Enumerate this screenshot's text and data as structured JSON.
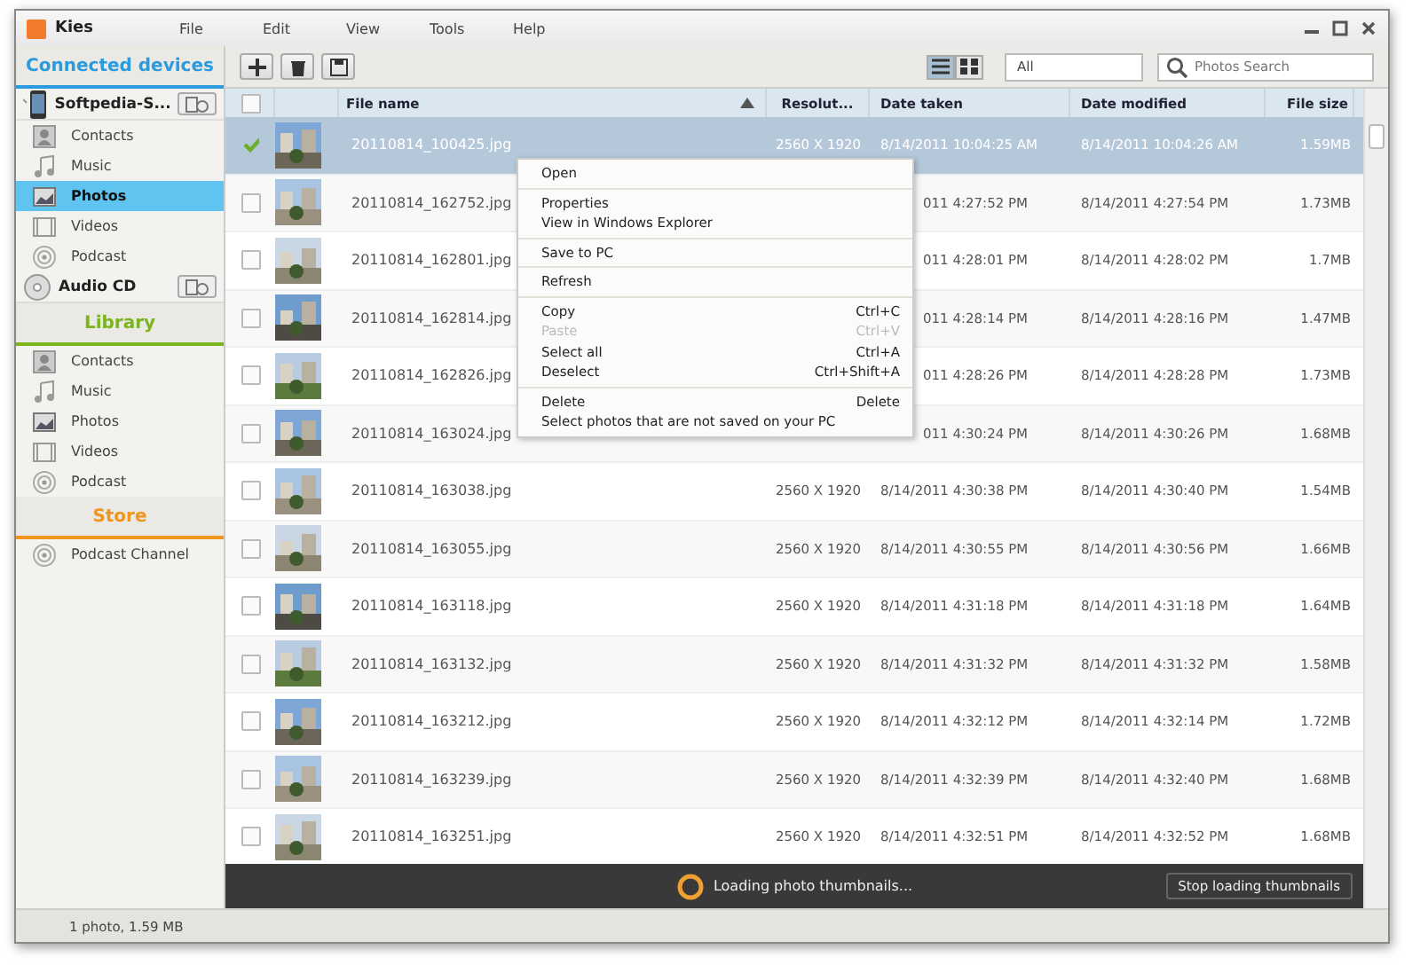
{
  "window": {
    "title": "Kies",
    "menu": [
      "File",
      "Edit",
      "View",
      "Tools",
      "Help"
    ]
  },
  "sidebar": {
    "sections": [
      {
        "title": "Connected devices",
        "color": "#2a9be0",
        "devices": [
          {
            "name": "Softpedia-S...",
            "kind": "phone",
            "items": [
              {
                "label": "Contacts",
                "kind": "contacts",
                "selected": false
              },
              {
                "label": "Music",
                "kind": "music",
                "selected": false
              },
              {
                "label": "Photos",
                "kind": "photos",
                "selected": true
              },
              {
                "label": "Videos",
                "kind": "videos",
                "selected": false
              },
              {
                "label": "Podcast",
                "kind": "podcast",
                "selected": false
              }
            ]
          },
          {
            "name": "Audio CD",
            "kind": "cd"
          }
        ]
      },
      {
        "title": "Library",
        "color": "#7ab51d",
        "items": [
          {
            "label": "Contacts",
            "kind": "contacts",
            "selected": false
          },
          {
            "label": "Music",
            "kind": "music",
            "selected": false
          },
          {
            "label": "Photos",
            "kind": "photos",
            "selected": false
          },
          {
            "label": "Videos",
            "kind": "videos",
            "selected": false
          },
          {
            "label": "Podcast",
            "kind": "podcast",
            "selected": false
          }
        ]
      },
      {
        "title": "Store",
        "color": "#f0961e",
        "items": [
          {
            "label": "Podcast Channel",
            "kind": "podcast",
            "selected": false
          }
        ]
      }
    ]
  },
  "toolbar": {
    "views": [
      {
        "kind": "list",
        "selected": true
      },
      {
        "kind": "grid",
        "selected": false
      }
    ],
    "filter": "All",
    "search": {
      "placeholder": "Photos Search"
    }
  },
  "table": {
    "select_all_checked": false,
    "columns": [
      "File name",
      "Resolut...",
      "Date taken",
      "Date modified",
      "File size"
    ],
    "rows": [
      {
        "file": "20110814_100425.jpg",
        "resolution": "2560 X 1920",
        "taken": "8/14/2011 10:04:25 AM",
        "modified": "8/14/2011 10:04:26 AM",
        "size": "1.59MB",
        "selected": true,
        "checked": true
      },
      {
        "file": "20110814_162752.jpg",
        "taken": "011 4:27:52 PM",
        "modified": "8/14/2011 4:27:54 PM",
        "size": "1.73MB",
        "selected": false,
        "checked": false
      },
      {
        "file": "20110814_162801.jpg",
        "taken": "011 4:28:01 PM",
        "modified": "8/14/2011 4:28:02 PM",
        "size": "1.7MB",
        "selected": false,
        "checked": false
      },
      {
        "file": "20110814_162814.jpg",
        "taken": "011 4:28:14 PM",
        "modified": "8/14/2011 4:28:16 PM",
        "size": "1.47MB",
        "selected": false,
        "checked": false
      },
      {
        "file": "20110814_162826.jpg",
        "taken": "011 4:28:26 PM",
        "modified": "8/14/2011 4:28:28 PM",
        "size": "1.73MB",
        "selected": false,
        "checked": false
      },
      {
        "file": "20110814_163024.jpg",
        "taken": "011 4:30:24 PM",
        "modified": "8/14/2011 4:30:26 PM",
        "size": "1.68MB",
        "selected": false,
        "checked": false
      },
      {
        "file": "20110814_163038.jpg",
        "resolution": "2560 X 1920",
        "taken": "8/14/2011 4:30:38 PM",
        "modified": "8/14/2011 4:30:40 PM",
        "size": "1.54MB",
        "selected": false,
        "checked": false
      },
      {
        "file": "20110814_163055.jpg",
        "resolution": "2560 X 1920",
        "taken": "8/14/2011 4:30:55 PM",
        "modified": "8/14/2011 4:30:56 PM",
        "size": "1.66MB",
        "selected": false,
        "checked": false
      },
      {
        "file": "20110814_163118.jpg",
        "resolution": "2560 X 1920",
        "taken": "8/14/2011 4:31:18 PM",
        "modified": "8/14/2011 4:31:18 PM",
        "size": "1.64MB",
        "selected": false,
        "checked": false
      },
      {
        "file": "20110814_163132.jpg",
        "resolution": "2560 X 1920",
        "taken": "8/14/2011 4:31:32 PM",
        "modified": "8/14/2011 4:31:32 PM",
        "size": "1.58MB",
        "selected": false,
        "checked": false
      },
      {
        "file": "20110814_163212.jpg",
        "resolution": "2560 X 1920",
        "taken": "8/14/2011 4:32:12 PM",
        "modified": "8/14/2011 4:32:14 PM",
        "size": "1.72MB",
        "selected": false,
        "checked": false
      },
      {
        "file": "20110814_163239.jpg",
        "resolution": "2560 X 1920",
        "taken": "8/14/2011 4:32:39 PM",
        "modified": "8/14/2011 4:32:40 PM",
        "size": "1.68MB",
        "selected": false,
        "checked": false
      },
      {
        "file": "20110814_163251.jpg",
        "resolution": "2560 X 1920",
        "taken": "8/14/2011 4:32:51 PM",
        "modified": "8/14/2011 4:32:52 PM",
        "size": "1.68MB",
        "selected": false,
        "checked": false
      }
    ]
  },
  "context_menu": {
    "groups": [
      [
        {
          "label": "Open",
          "disabled": false
        }
      ],
      [
        {
          "label": "Properties",
          "disabled": false
        },
        {
          "label": "View in Windows Explorer",
          "disabled": false
        }
      ],
      [
        {
          "label": "Save to PC",
          "disabled": false
        }
      ],
      [
        {
          "label": "Refresh",
          "disabled": false
        }
      ],
      [
        {
          "label": "Copy",
          "shortcut": "Ctrl+C",
          "disabled": false
        },
        {
          "label": "Paste",
          "shortcut": "Ctrl+V",
          "disabled": true
        },
        {
          "label": "Select all",
          "shortcut": "Ctrl+A",
          "disabled": false
        },
        {
          "label": "Deselect",
          "shortcut": "Ctrl+Shift+A",
          "disabled": false
        }
      ],
      [
        {
          "label": "Delete",
          "shortcut": "Delete",
          "disabled": false
        },
        {
          "label": "Select photos that are not saved on your PC",
          "disabled": false
        }
      ]
    ]
  },
  "loading": {
    "message": "Loading photo thumbnails...",
    "button": "Stop loading thumbnails"
  },
  "status_bar": "1 photo, 1.59 MB"
}
